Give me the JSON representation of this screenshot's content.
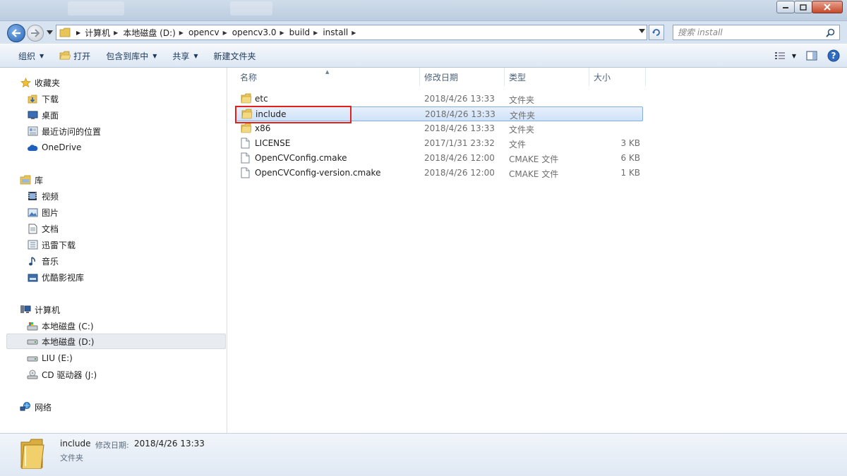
{
  "addressbar": {
    "breadcrumbs": [
      "计算机",
      "本地磁盘 (D:)",
      "opencv",
      "opencv3.0",
      "build",
      "install"
    ]
  },
  "search": {
    "placeholder": "搜索 install"
  },
  "toolbar": {
    "organize": "组织",
    "open": "打开",
    "include_in_library": "包含到库中",
    "share": "共享",
    "new_folder": "新建文件夹"
  },
  "sidebar": {
    "favorites": {
      "label": "收藏夹",
      "items": [
        "下载",
        "桌面",
        "最近访问的位置",
        "OneDrive"
      ]
    },
    "libraries": {
      "label": "库",
      "items": [
        "视频",
        "图片",
        "文档",
        "迅雷下载",
        "音乐",
        "优酷影视库"
      ]
    },
    "computer": {
      "label": "计算机",
      "items": [
        "本地磁盘 (C:)",
        "本地磁盘 (D:)",
        "LIU (E:)",
        "CD 驱动器 (J:)"
      ]
    },
    "network": {
      "label": "网络"
    }
  },
  "columns": {
    "name": "名称",
    "date": "修改日期",
    "type": "类型",
    "size": "大小"
  },
  "files": [
    {
      "name": "etc",
      "date": "2018/4/26 13:33",
      "type": "文件夹",
      "size": ""
    },
    {
      "name": "include",
      "date": "2018/4/26 13:33",
      "type": "文件夹",
      "size": ""
    },
    {
      "name": "x86",
      "date": "2018/4/26 13:33",
      "type": "文件夹",
      "size": ""
    },
    {
      "name": "LICENSE",
      "date": "2017/1/31 23:32",
      "type": "文件",
      "size": "3 KB"
    },
    {
      "name": "OpenCVConfig.cmake",
      "date": "2018/4/26 12:00",
      "type": "CMAKE 文件",
      "size": "6 KB"
    },
    {
      "name": "OpenCVConfig-version.cmake",
      "date": "2018/4/26 12:00",
      "type": "CMAKE 文件",
      "size": "1 KB"
    }
  ],
  "details": {
    "name": "include",
    "date_label": "修改日期:",
    "date_value": "2018/4/26 13:33",
    "type": "文件夹"
  },
  "colors": {
    "accent": "#2a64b3",
    "selection": "#cfe2f8",
    "annotation": "#e4201f"
  }
}
